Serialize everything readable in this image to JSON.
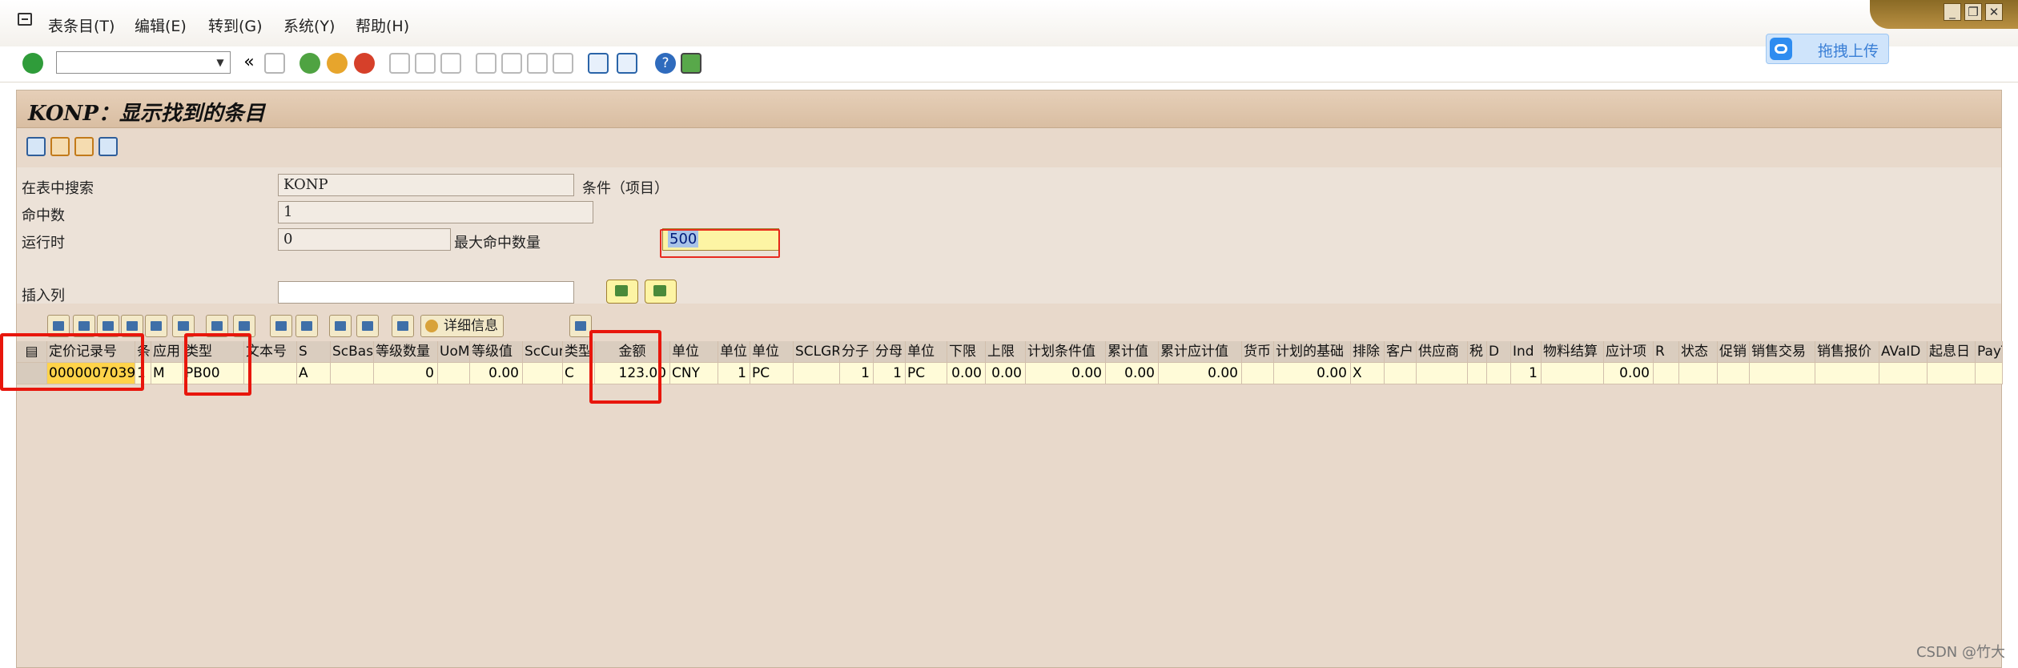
{
  "menu": {
    "items": [
      "表条目(T)",
      "编辑(E)",
      "转到(G)",
      "系统(Y)",
      "帮助(H)"
    ]
  },
  "window_controls": [
    "_",
    "❐",
    "✕"
  ],
  "baidu_upload": {
    "label": "拖拽上传"
  },
  "page": {
    "title": "KONP：显示找到的条目"
  },
  "form": {
    "search_label": "在表中搜索",
    "search_value": "KONP",
    "search_suffix": "条件（项目）",
    "hits_label": "命中数",
    "hits_value": "1",
    "runtime_label": "运行时",
    "runtime_value": "0",
    "max_hits_label": "最大命中数量",
    "max_hits_value": "500",
    "insert_col_label": "插入列",
    "insert_col_value": ""
  },
  "alv": {
    "detail_label": "详细信息"
  },
  "grid": {
    "headers": [
      "",
      "定价记录号",
      "条",
      "应用",
      "类型",
      "文本号",
      "S",
      "ScBas",
      "等级数量",
      "UoM",
      "等级值",
      "ScCur",
      "类型",
      "金额",
      "单位",
      "单位",
      "单位",
      "SCLGR",
      "分子",
      "分母",
      "单位",
      "下限",
      "上限",
      "计划条件值",
      "累计值",
      "累计应计值",
      "货币",
      "计划的基础",
      "排除",
      "客户",
      "供应商",
      "税",
      "D",
      "Ind",
      "物料结算",
      "应计项",
      "R",
      "状态",
      "促销",
      "销售交易",
      "销售报价",
      "AVaID",
      "起息日",
      "PayT"
    ],
    "row": [
      "",
      "0000007039",
      "1",
      "M",
      "PB00",
      "",
      "A",
      "",
      "0",
      "",
      "0.00",
      "",
      "C",
      "123.00",
      "CNY",
      "1",
      "PC",
      "",
      "1",
      "1",
      "PC",
      "0.00",
      "0.00",
      "0.00",
      "0.00",
      "0.00",
      "",
      "0.00",
      "X",
      "",
      "",
      "",
      "",
      "1",
      "",
      "0.00",
      "",
      "",
      "",
      "",
      "",
      "",
      "",
      ""
    ]
  },
  "colors": {
    "annotation": "#e8160c",
    "key_cell": "#ffd34a",
    "panel": "#e8d9cb"
  },
  "watermark": "CSDN @竹大"
}
